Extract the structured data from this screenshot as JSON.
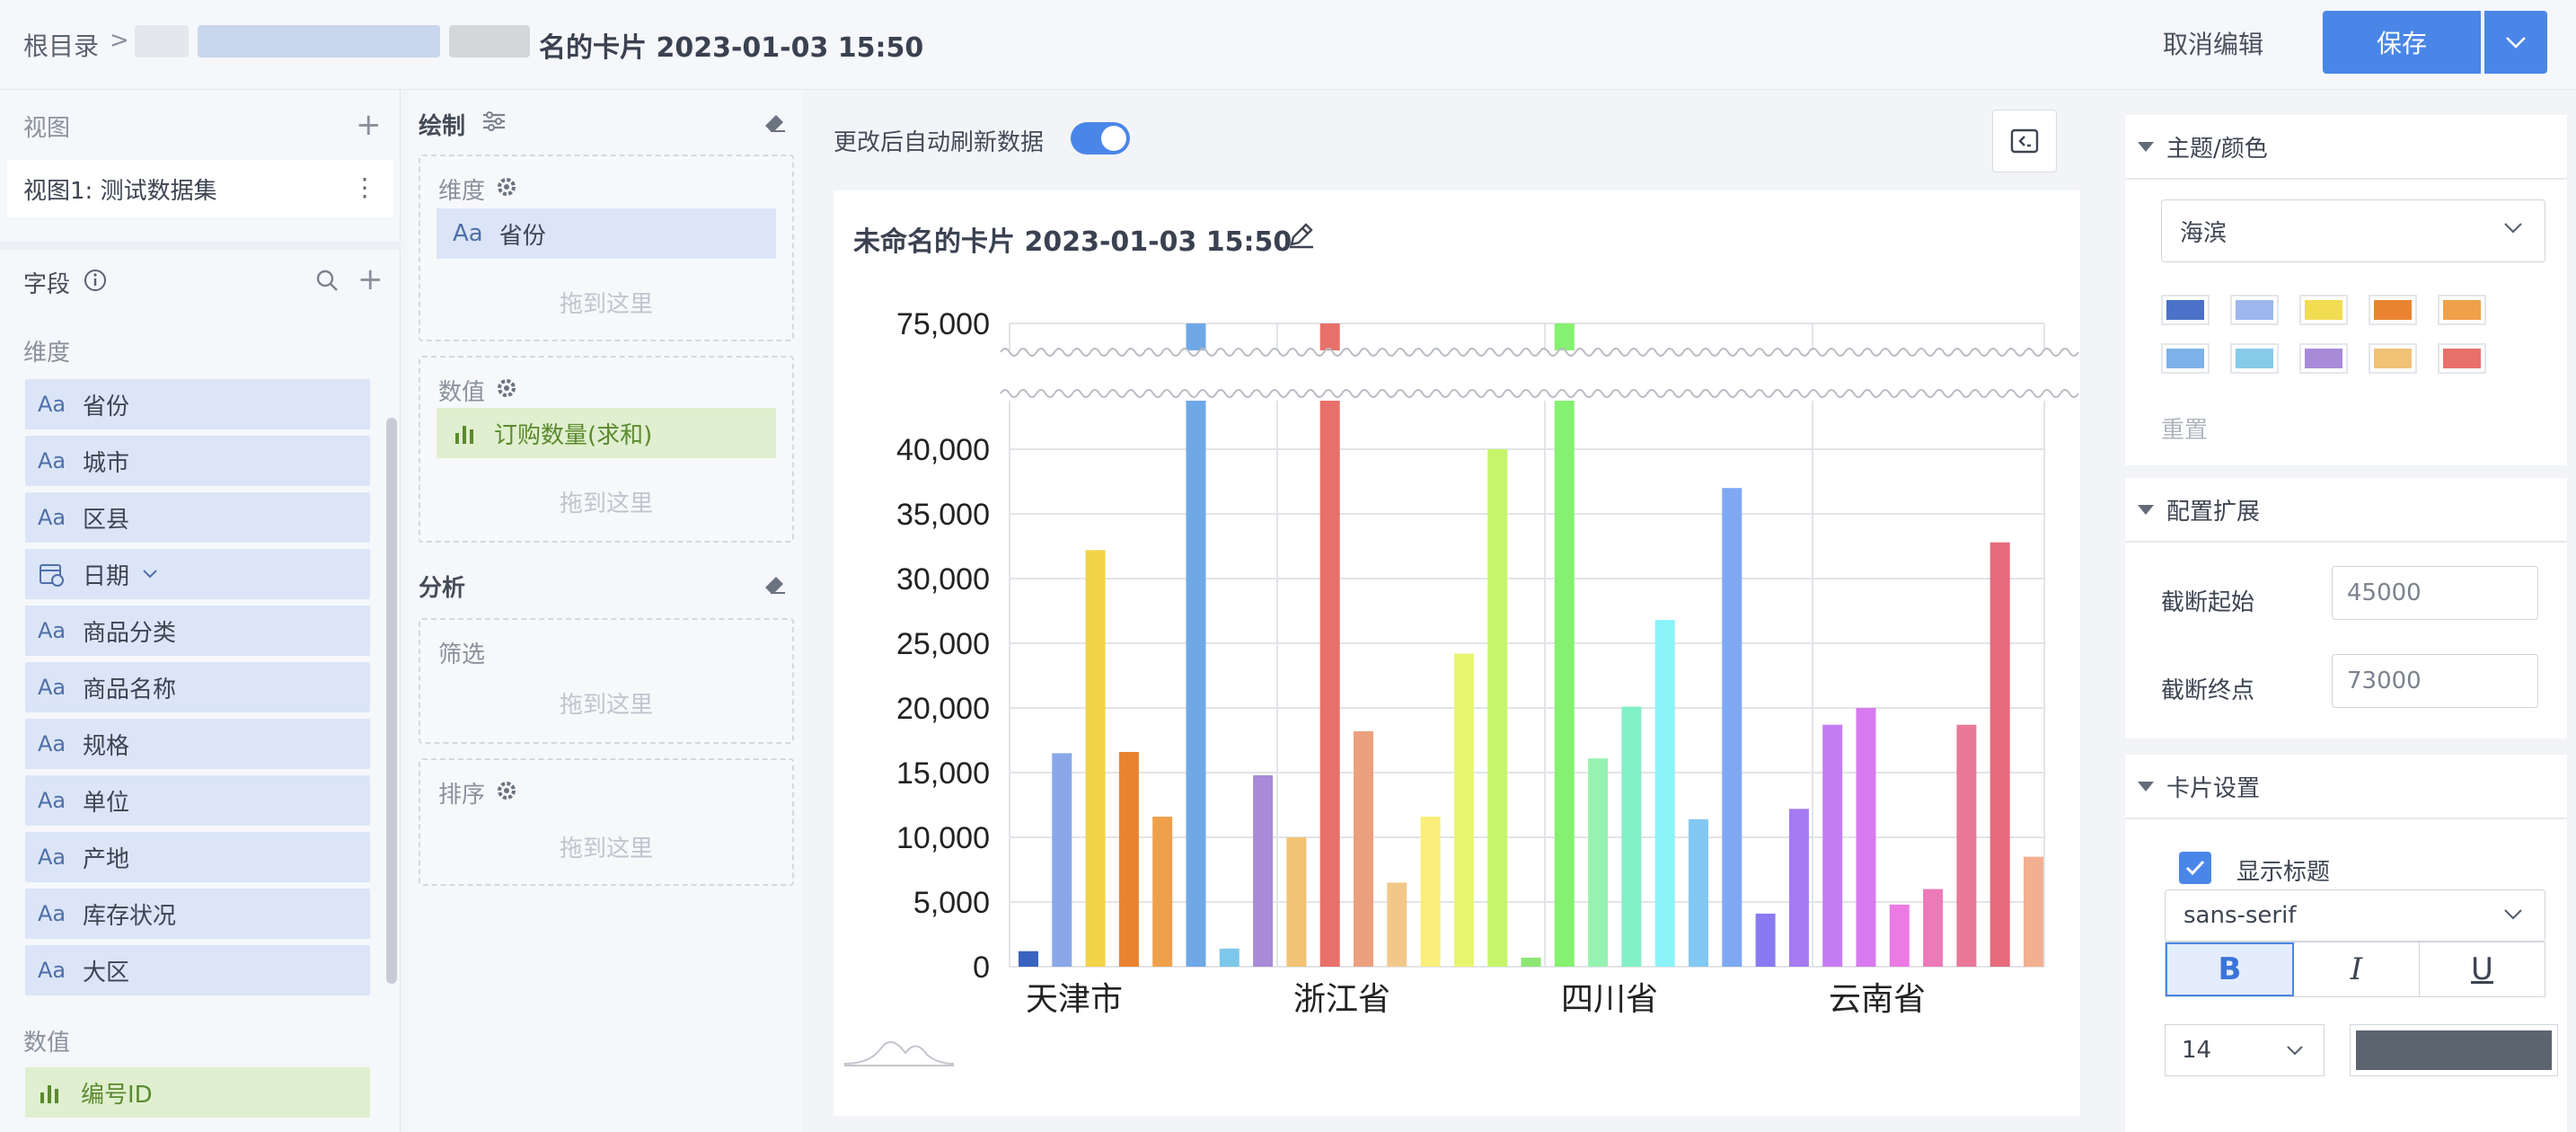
{
  "breadcrumb": {
    "root": "根目录",
    "sep": ">",
    "title": "名的卡片 2023-01-03 15:50"
  },
  "topbar": {
    "cancel": "取消编辑",
    "save": "保存"
  },
  "left": {
    "views_title": "视图",
    "view_item": "视图1: 测试数据集",
    "fields_title": "字段",
    "dim_title": "维度",
    "dims": [
      "省份",
      "城市",
      "区县",
      "日期",
      "商品分类",
      "商品名称",
      "规格",
      "单位",
      "产地",
      "库存状况",
      "大区"
    ],
    "aa": "Aa",
    "num_title": "数值",
    "nums": [
      "编号ID"
    ]
  },
  "draw": {
    "title": "绘制",
    "dim_label": "维度",
    "dim_pill": "省份",
    "val_label": "数值",
    "val_pill": "订购数量(求和)",
    "drop_hint": "拖到这里",
    "analysis_title": "分析",
    "filter_label": "筛选",
    "sort_label": "排序"
  },
  "canvas": {
    "auto_refresh": "更改后自动刷新数据",
    "card_title": "未命名的卡片 2023-01-03 15:50"
  },
  "chart_data": {
    "type": "bar",
    "title": "",
    "y_ticks": [
      "0",
      "5,000",
      "10,000",
      "15,000",
      "20,000",
      "25,000",
      "30,000",
      "35,000",
      "40,000",
      "75,000"
    ],
    "x_tick_labels": [
      "天津市",
      "浙江省",
      "四川省",
      "云南省"
    ],
    "y_break": [
      45000,
      73000
    ],
    "ylim": [
      0,
      75000
    ],
    "values": [
      1200,
      16500,
      32200,
      16600,
      11600,
      75000,
      1400,
      14800,
      10000,
      75000,
      18200,
      6500,
      11600,
      24200,
      40000,
      700,
      75000,
      16100,
      20100,
      26800,
      11400,
      37000,
      4100,
      12200,
      18700,
      20000,
      4800,
      6000,
      18700,
      32800,
      8500
    ],
    "colors": [
      "#3a63c0",
      "#8aa8e8",
      "#f2d246",
      "#e98330",
      "#f0a04a",
      "#6ea8e6",
      "#7dc7ea",
      "#a78ad8",
      "#f2c275",
      "#e8706a",
      "#eca07e",
      "#f2c88a",
      "#fbef7c",
      "#e8f56f",
      "#c6f56a",
      "#8de574",
      "#86f070",
      "#96f2b0",
      "#82f0c6",
      "#8af3f8",
      "#82c8f4",
      "#7ea8f2",
      "#8a7af2",
      "#a67af2",
      "#c57cf2",
      "#d87af0",
      "#ec7ae4",
      "#ec7ab8",
      "#ea7898",
      "#e86a7c",
      "#f2b090"
    ],
    "grid": true
  },
  "right": {
    "theme_title": "主题/颜色",
    "theme_value": "海滨",
    "palette": [
      "#4a72c8",
      "#9db6ec",
      "#f2dc52",
      "#e98330",
      "#f0a04a",
      "#7db2e8",
      "#86cbe8",
      "#a78ad8",
      "#f2c275",
      "#e8706a"
    ],
    "reset": "重置",
    "ext_title": "配置扩展",
    "break_start_label": "截断起始",
    "break_start": "45000",
    "break_end_label": "截断终点",
    "break_end": "73000",
    "card_title": "卡片设置",
    "show_title": "显示标题",
    "font": "sans-serif",
    "bold": "B",
    "italic": "I",
    "underline": "U",
    "size": "14"
  }
}
